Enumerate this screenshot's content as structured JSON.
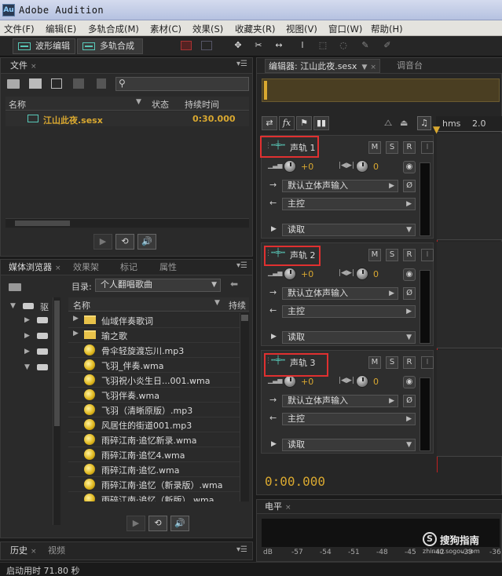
{
  "window": {
    "app_icon": "Au",
    "title": "Adobe Audition"
  },
  "menu": [
    "文件(F)",
    "编辑(E)",
    "多轨合成(M)",
    "素材(C)",
    "效果(S)",
    "收藏夹(R)",
    "视图(V)",
    "窗口(W)",
    "帮助(H)"
  ],
  "toolbar": {
    "waveform_label": "波形编辑",
    "multitrack_label": "多轨合成"
  },
  "files_panel": {
    "tab": "文件",
    "col_name": "名称",
    "col_status": "状态",
    "col_duration": "持续时间",
    "row": {
      "name": "江山此夜.sesx",
      "duration": "0:30.000"
    }
  },
  "media_panel": {
    "tabs": [
      "媒体浏览器",
      "效果架",
      "标记",
      "属性"
    ],
    "dir_label": "目录:",
    "dir_value": "个人翻唱歌曲",
    "tree_root": "驱",
    "col_name": "名称",
    "col_duration": "持续",
    "items": [
      {
        "name": "仙域伴奏歌词",
        "type": "folder"
      },
      {
        "name": "瑜之歌",
        "type": "folder"
      },
      {
        "name": "骨伞轻旋渡忘川.mp3",
        "type": "audio"
      },
      {
        "name": "飞羽_伴奏.wma",
        "type": "audio"
      },
      {
        "name": "飞羽祝小炎生日...001.wma",
        "type": "audio"
      },
      {
        "name": "飞羽伴奏.wma",
        "type": "audio"
      },
      {
        "name": "飞羽（清晰原版）.mp3",
        "type": "audio"
      },
      {
        "name": "风居住的街道001.mp3",
        "type": "audio"
      },
      {
        "name": "雨碎江南·追忆新录.wma",
        "type": "audio"
      },
      {
        "name": "雨碎江南·追忆4.wma",
        "type": "audio"
      },
      {
        "name": "雨碎江南·追忆.wma",
        "type": "audio"
      },
      {
        "name": "雨碎江南·追忆（新录版）.wma",
        "type": "audio"
      },
      {
        "name": "雨碎江南·追忆（新版）.wma",
        "type": "audio"
      }
    ]
  },
  "history_panel": {
    "tabs": [
      "历史",
      "视频"
    ]
  },
  "editor": {
    "tab": "编辑器: 江山此夜.sesx",
    "mixer_tab": "调音台",
    "ruler_unit": "hms",
    "ruler_mark": "2.0",
    "time": "0:00.000"
  },
  "tracks": [
    {
      "name": "声轨 1",
      "volume": "+0",
      "pan": "0",
      "input": "默认立体声输入",
      "output": "主控",
      "mode": "读取"
    },
    {
      "name": "声轨 2",
      "volume": "+0",
      "pan": "0",
      "input": "默认立体声输入",
      "output": "主控",
      "mode": "读取"
    },
    {
      "name": "声轨 3",
      "volume": "+0",
      "pan": "0",
      "input": "默认立体声输入",
      "output": "主控",
      "mode": "读取"
    }
  ],
  "track_buttons": {
    "mute": "M",
    "solo": "S",
    "record": "R",
    "input_monitor": "I"
  },
  "level_panel": {
    "tab": "电平",
    "scale": [
      "dB",
      "-57",
      "-54",
      "-51",
      "-48",
      "-45",
      "-42",
      "-39",
      "-36"
    ]
  },
  "watermark": {
    "text": "搜狗指南",
    "url": "zhinan.sogou.com"
  },
  "status": {
    "text": "启动用时 71.80 秒"
  },
  "colors": {
    "accent_gold": "#d9a830",
    "highlight_red": "#e03030",
    "playhead_red": "#c02020",
    "waveform_teal": "#58c8b8"
  }
}
